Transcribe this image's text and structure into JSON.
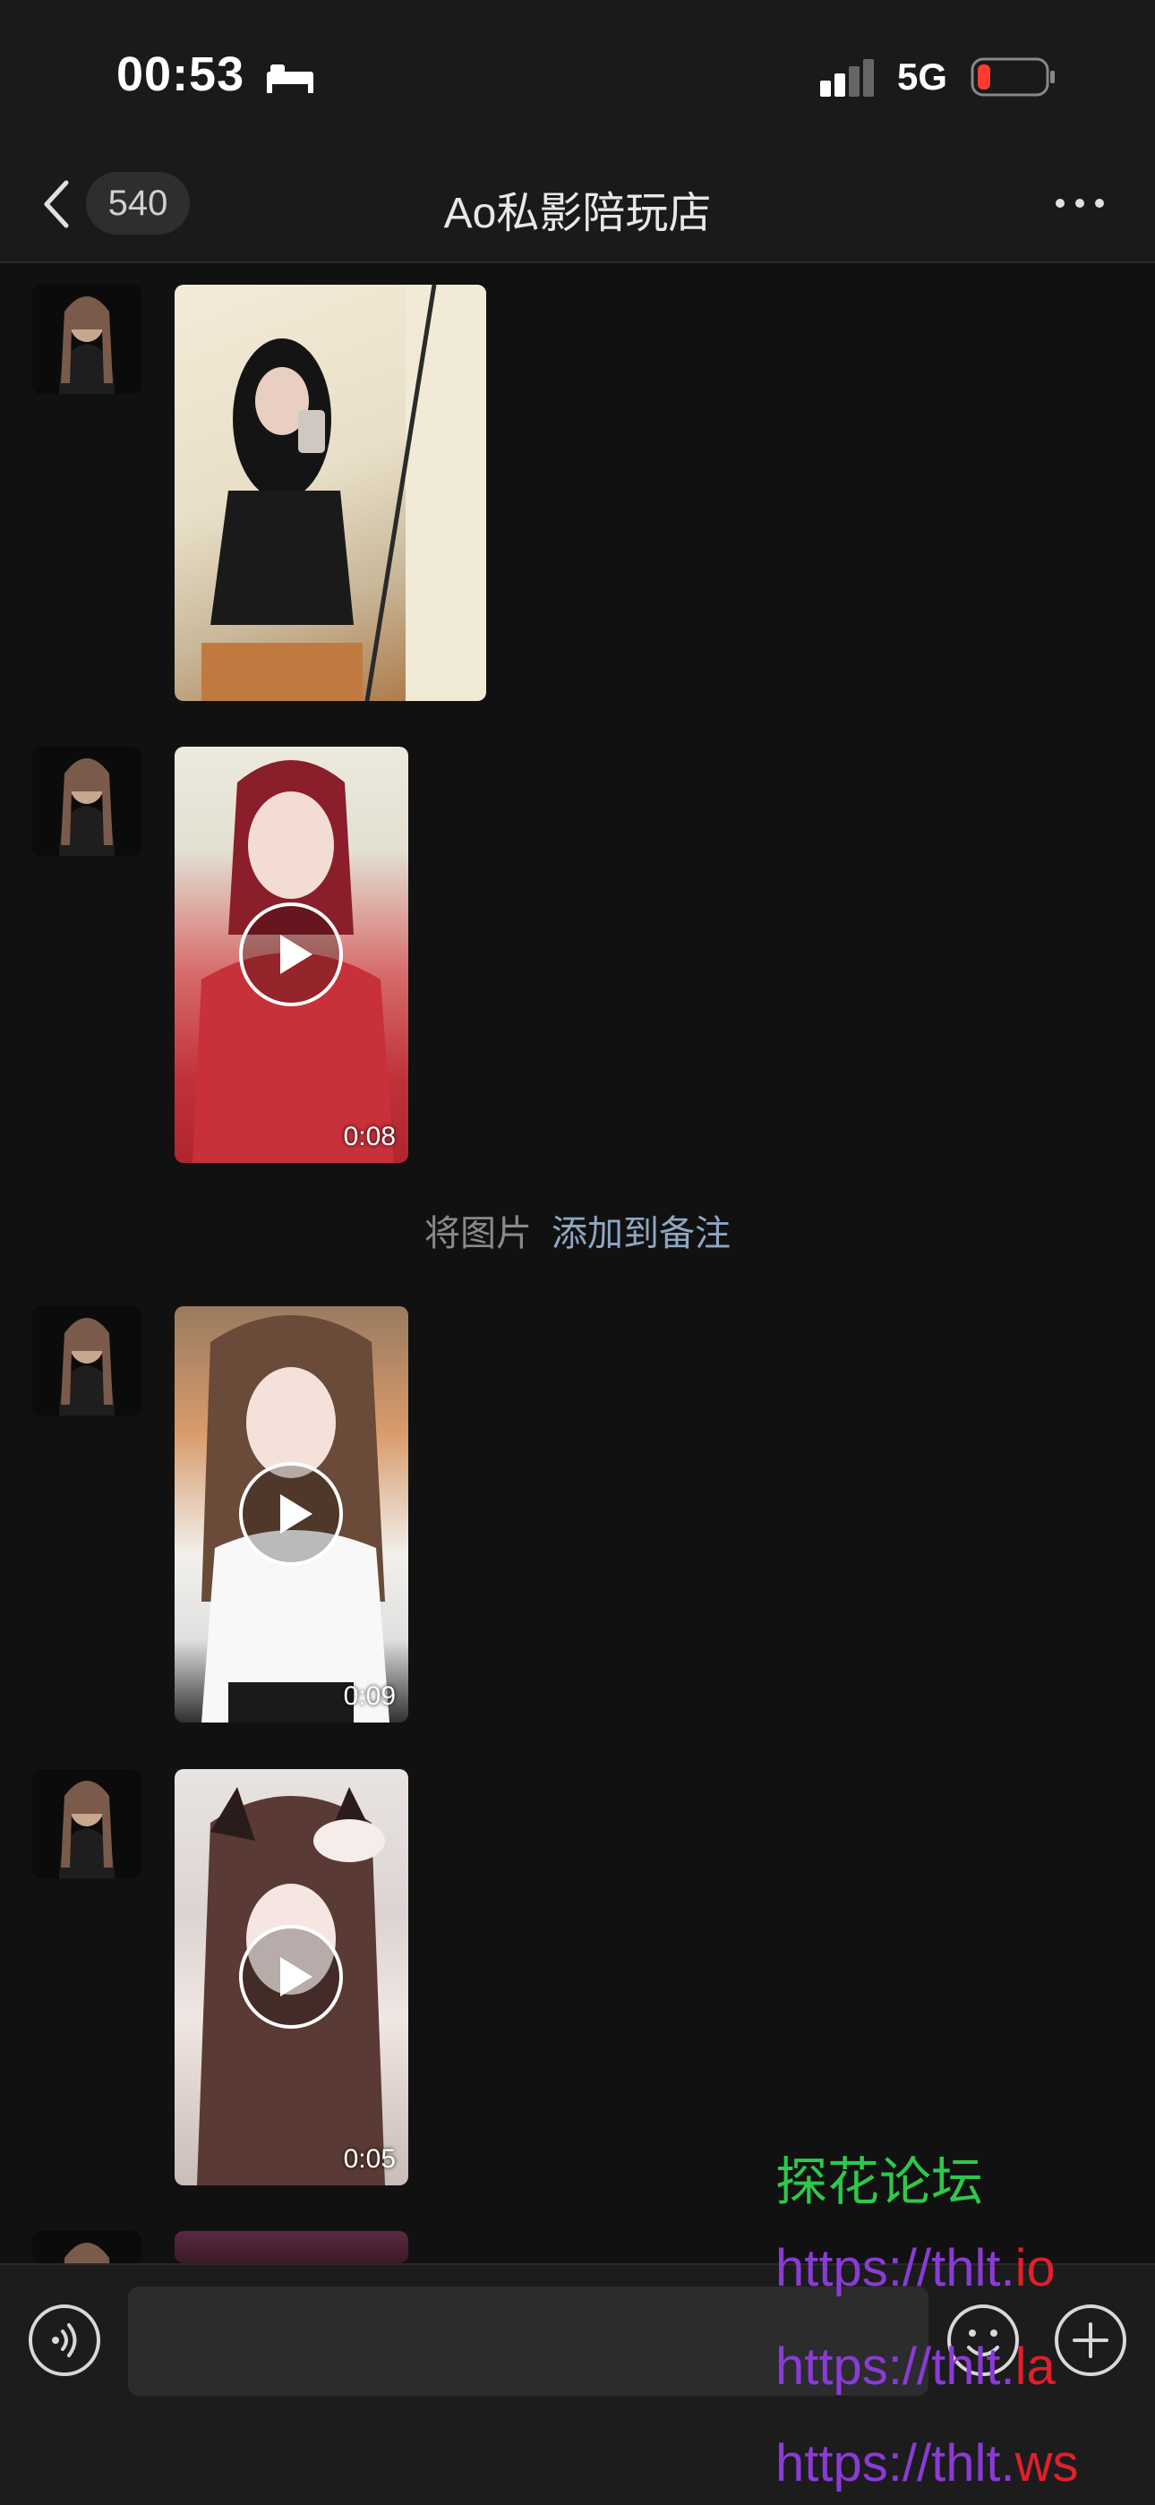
{
  "status_bar": {
    "time": "00:53",
    "network": "5G",
    "battery_color": "#ff3b30"
  },
  "nav": {
    "unread_count": "540",
    "title": "Ao私影陪玩店"
  },
  "messages": [
    {
      "type": "image"
    },
    {
      "type": "video",
      "duration": "0:08"
    },
    {
      "type": "video",
      "duration": "0:09"
    },
    {
      "type": "video",
      "duration": "0:05"
    },
    {
      "type": "image"
    }
  ],
  "system_tip": {
    "text": "将图片",
    "link": "添加到备注"
  },
  "input_bar": {
    "placeholder": ""
  },
  "watermark": {
    "title": "探花论坛",
    "urls": [
      {
        "prefix": "https://thlt.",
        "suffix": "io"
      },
      {
        "prefix": "https://thlt.",
        "suffix": "la"
      },
      {
        "prefix": "https://thlt.",
        "suffix": "ws"
      }
    ]
  }
}
